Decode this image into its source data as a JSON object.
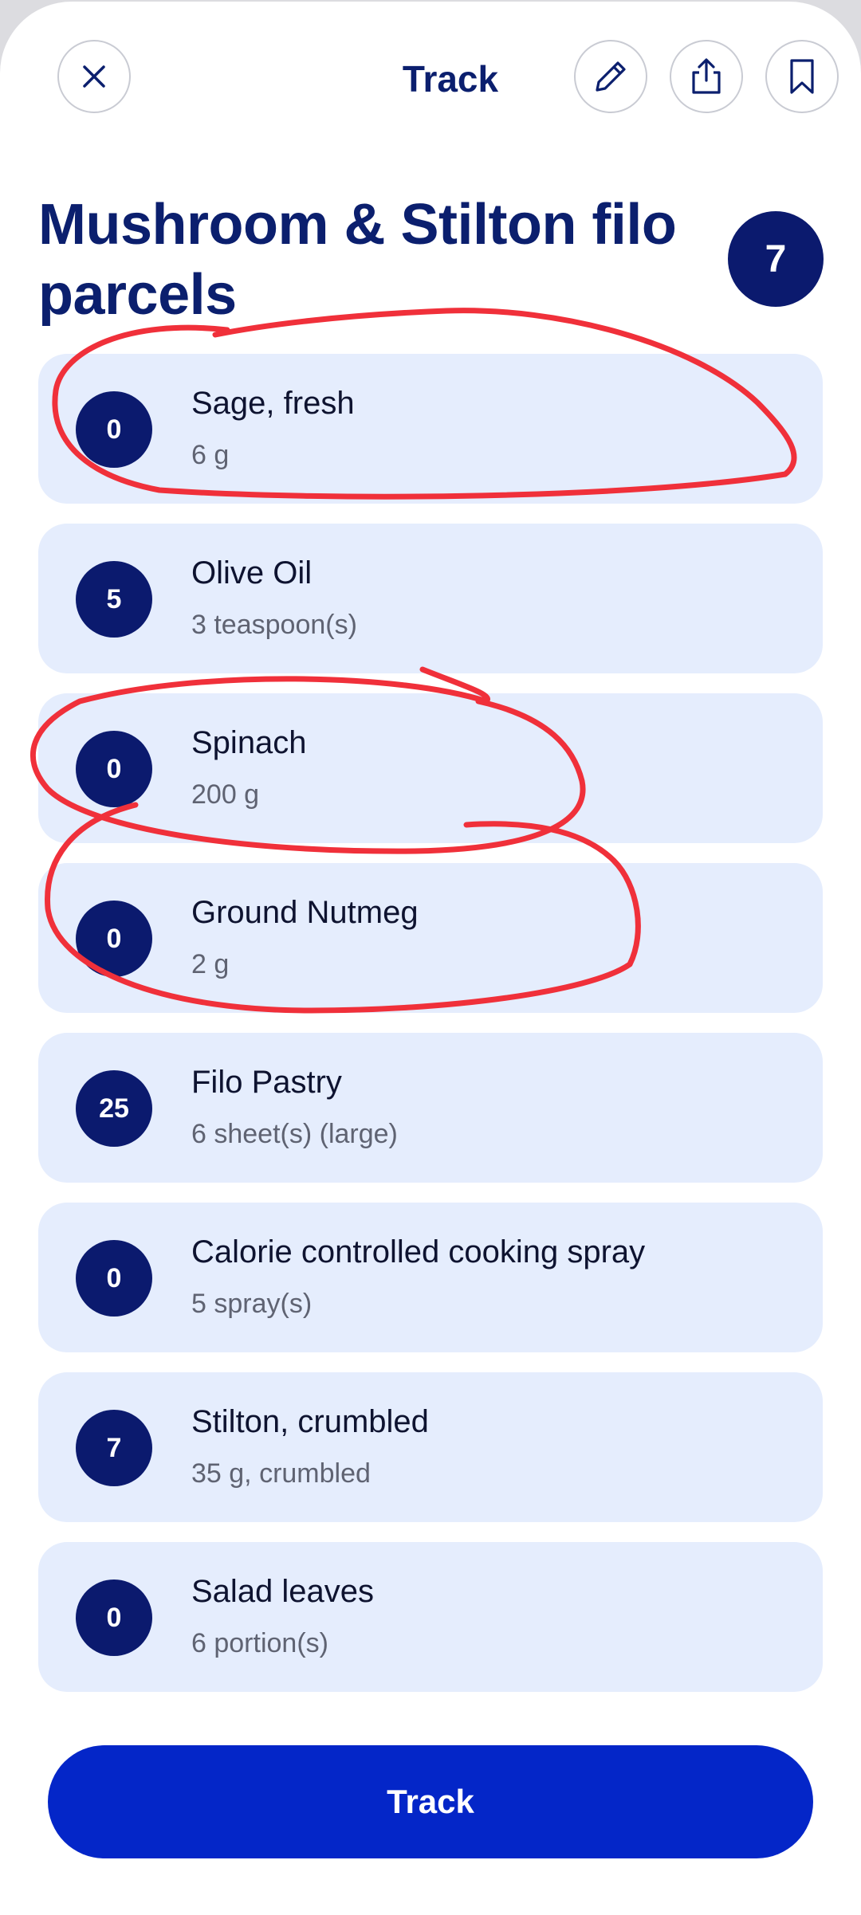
{
  "header": {
    "title": "Track",
    "close_icon": "close-icon",
    "edit_icon": "pencil-icon",
    "share_icon": "share-icon",
    "bookmark_icon": "bookmark-icon"
  },
  "recipe": {
    "title": "Mushroom & Stilton filo parcels",
    "points": "7"
  },
  "ingredients": [
    {
      "points": "0",
      "name": "Sage, fresh",
      "amount": "6 g"
    },
    {
      "points": "5",
      "name": "Olive Oil",
      "amount": "3 teaspoon(s)"
    },
    {
      "points": "0",
      "name": "Spinach",
      "amount": "200 g"
    },
    {
      "points": "0",
      "name": "Ground Nutmeg",
      "amount": "2 g"
    },
    {
      "points": "25",
      "name": "Filo Pastry",
      "amount": "6 sheet(s) (large)"
    },
    {
      "points": "0",
      "name": "Calorie controlled cooking spray",
      "amount": "5 spray(s)"
    },
    {
      "points": "7",
      "name": "Stilton, crumbled",
      "amount": "35 g, crumbled"
    },
    {
      "points": "0",
      "name": "Salad leaves",
      "amount": "6 portion(s)"
    }
  ],
  "footer": {
    "track_label": "Track"
  },
  "colors": {
    "navy": "#0b1a6e",
    "card_bg": "#e5edfd",
    "primary_button": "#0426c8",
    "annotation_red": "#f0303a"
  }
}
